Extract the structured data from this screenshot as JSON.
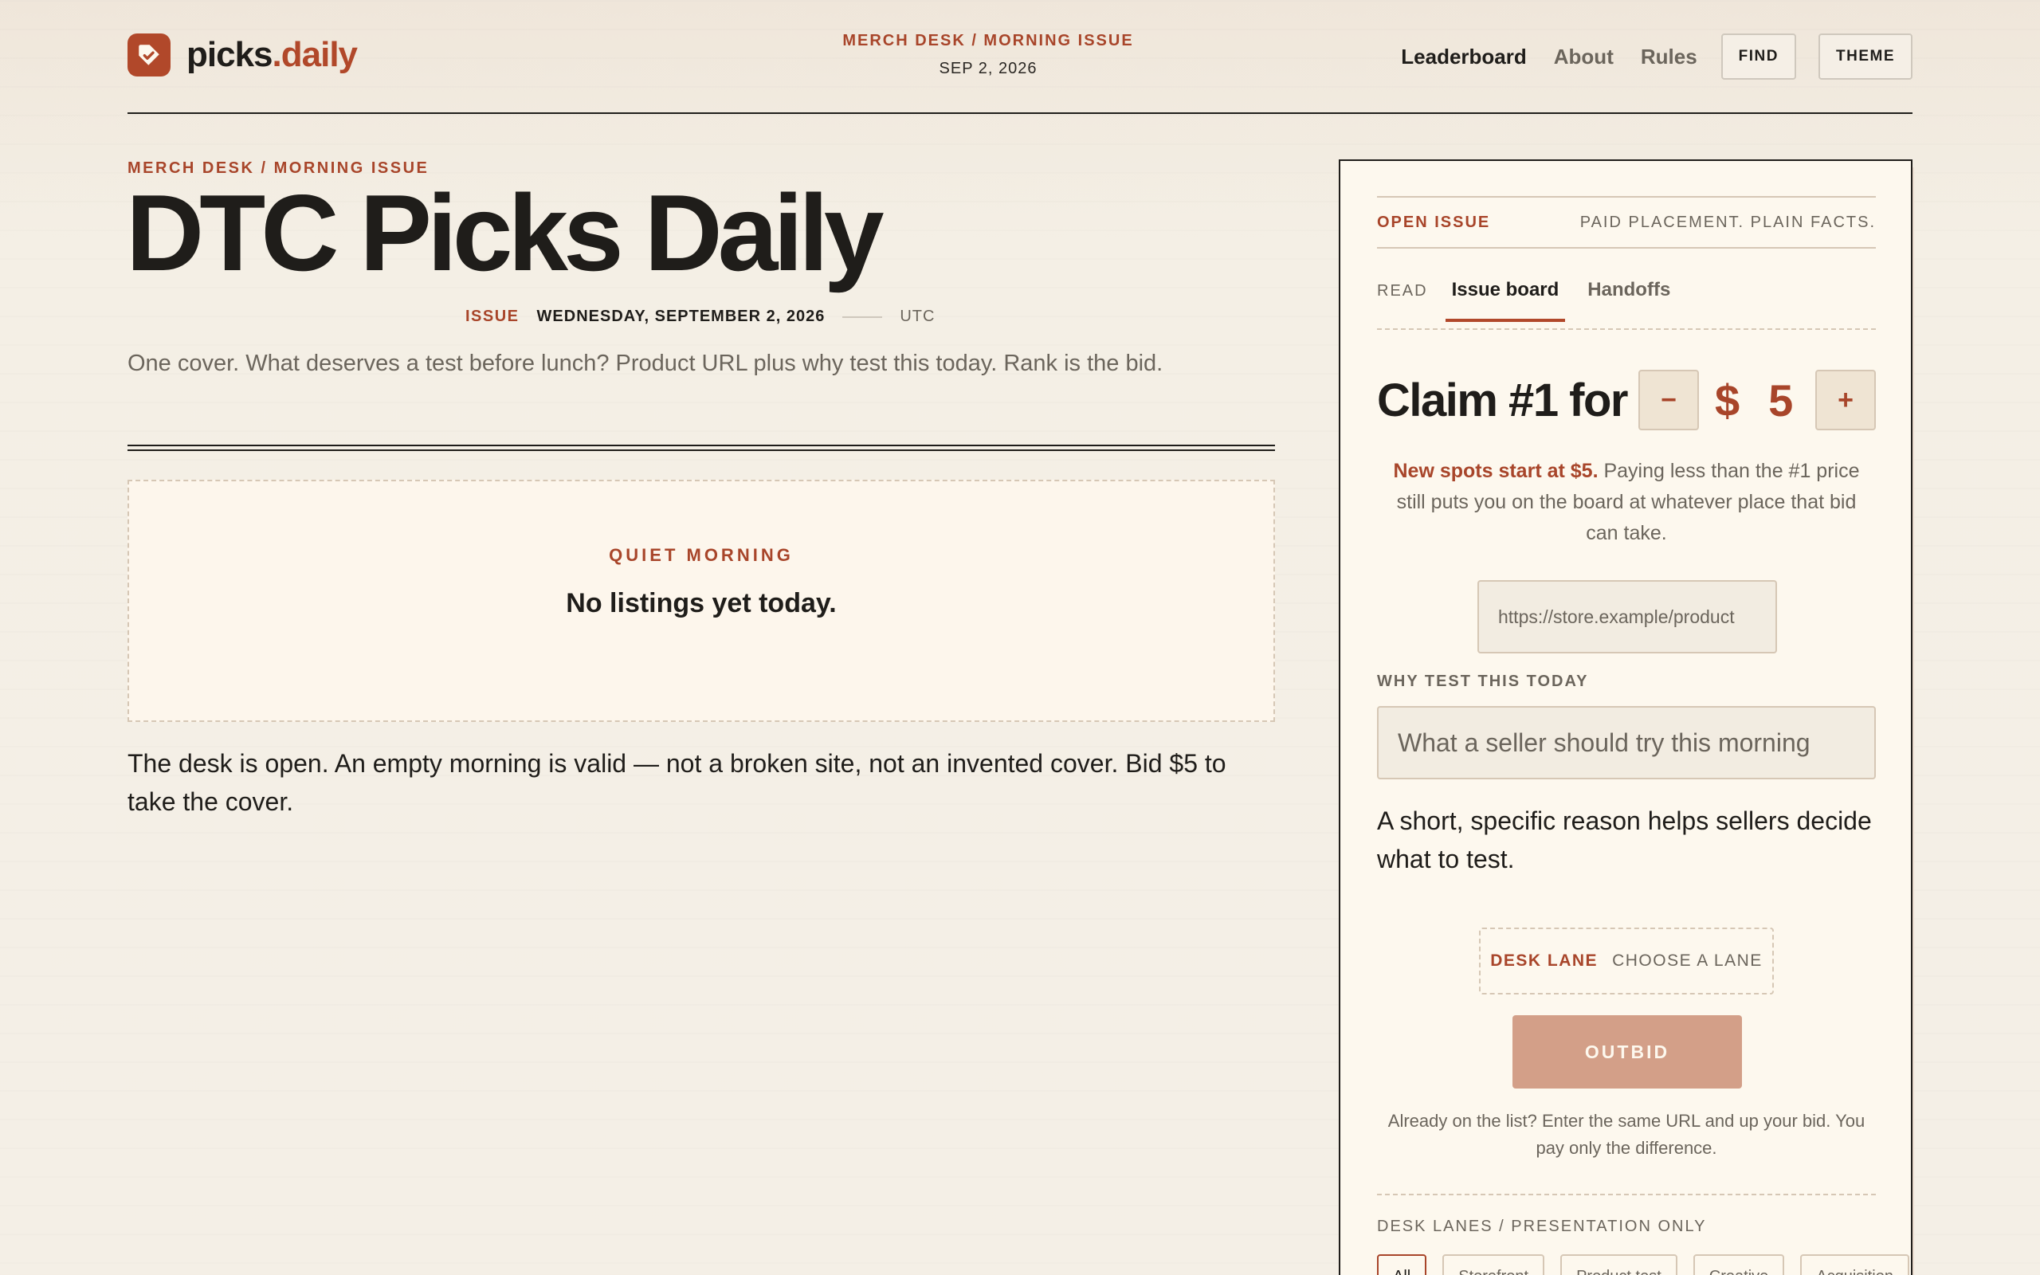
{
  "brand": {
    "name": "picks",
    "suffix": ".daily",
    "icon": "tag-check-icon"
  },
  "header": {
    "kicker": "MERCH DESK / MORNING ISSUE",
    "date": "SEP 2, 2026"
  },
  "nav": {
    "links": [
      "Leaderboard",
      "About",
      "Rules"
    ],
    "find": "FIND",
    "theme": "THEME"
  },
  "main": {
    "kicker": "MERCH DESK / MORNING ISSUE",
    "title": "DTC Picks Daily",
    "issue_label": "ISSUE",
    "issue_date": "WEDNESDAY, SEPTEMBER 2, 2026",
    "timezone": "UTC",
    "lede": "One cover. What deserves a test before lunch? Product URL plus why test this today. Rank is the bid.",
    "empty_kicker": "QUIET MORNING",
    "empty_title": "No listings yet today.",
    "desk_note": "The desk is open. An empty morning is valid — not a broken site, not an invented cover. Bid $5 to take the cover."
  },
  "panel": {
    "open_issue": "OPEN ISSUE",
    "tagline": "PAID PLACEMENT. PLAIN FACTS.",
    "tabs": {
      "read": "READ",
      "board": "Issue board",
      "handoffs": "Handoffs"
    },
    "claim_text": "Claim #1 for",
    "minus": "−",
    "plus": "+",
    "currency": "$",
    "bid": "5",
    "spots_bold": "New spots start at $5.",
    "spots_rest": " Paying less than the #1 price still puts you on the board at whatever place that bid can take.",
    "url_placeholder": "https://store.example/product",
    "why_label": "WHY TEST THIS TODAY",
    "why_placeholder": "What a seller should try this morning",
    "why_help": "A short, specific reason helps sellers decide what to test.",
    "lane_label": "DESK LANE",
    "lane_choose": "CHOOSE A LANE",
    "outbid": "OUTBID",
    "already": "Already on the list? Enter the same URL and up your bid. You pay only the difference.",
    "lanes_label": "DESK LANES / PRESENTATION ONLY",
    "chips": [
      "All",
      "Storefront",
      "Product test",
      "Creative",
      "Acquisition"
    ]
  },
  "colors": {
    "accent": "#a8452a",
    "ink": "#1f1d1a",
    "muted": "#6b655c",
    "button_disabled": "#d39f88"
  }
}
